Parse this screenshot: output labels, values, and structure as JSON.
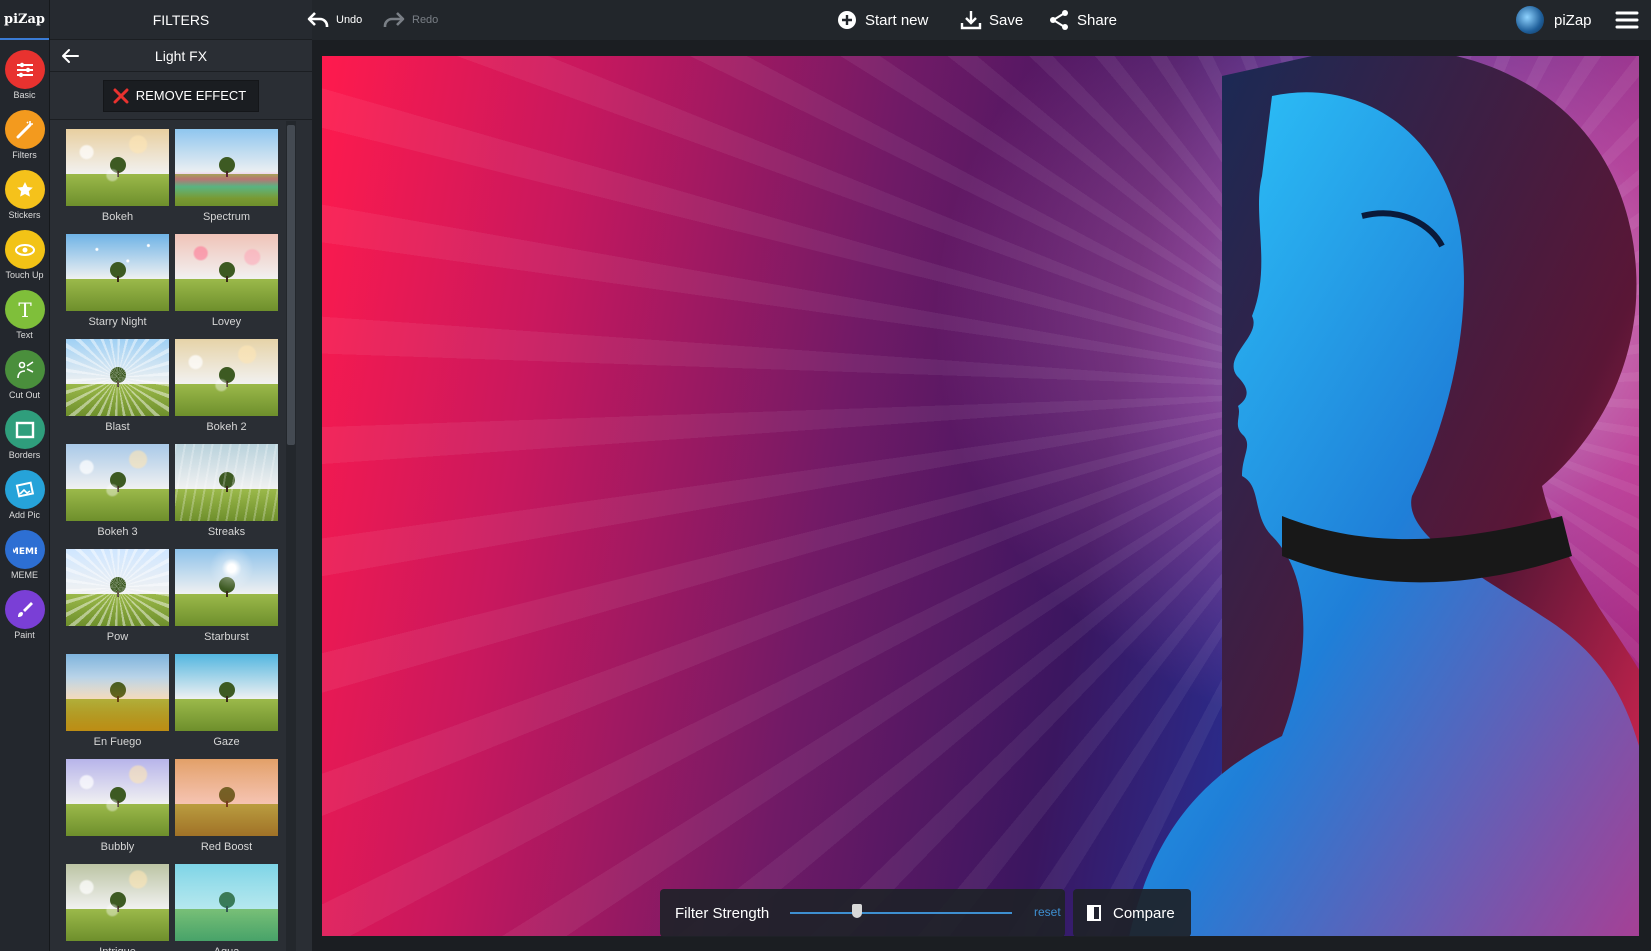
{
  "app": {
    "logo": "piZap"
  },
  "rail": [
    {
      "label": "Basic",
      "icon": "sliders-icon",
      "color": "#e8322f"
    },
    {
      "label": "Filters",
      "icon": "magic-wand-icon",
      "color": "#f39a1e"
    },
    {
      "label": "Stickers",
      "icon": "sticker-icon",
      "color": "#f5c21b"
    },
    {
      "label": "Touch Up",
      "icon": "eye-icon",
      "color": "#f2c316"
    },
    {
      "label": "Text",
      "icon": "text-icon",
      "color": "#7fbf3a"
    },
    {
      "label": "Cut Out",
      "icon": "cutout-icon",
      "color": "#4a8f3c"
    },
    {
      "label": "Borders",
      "icon": "border-icon",
      "color": "#2f9e7c"
    },
    {
      "label": "Add Pic",
      "icon": "add-picture-icon",
      "color": "#26a3d9"
    },
    {
      "label": "MEME",
      "icon": "meme-icon",
      "color": "#2d6fd3"
    },
    {
      "label": "Paint",
      "icon": "paintbrush-icon",
      "color": "#7a3fd6"
    }
  ],
  "panel": {
    "title": "FILTERS",
    "subtitle": "Light FX",
    "remove_label": "REMOVE EFFECT"
  },
  "filters": [
    {
      "label": "Bokeh",
      "sky": "#e8cfa0",
      "fx": "bokeh"
    },
    {
      "label": "Spectrum",
      "sky": "#8fc6ef",
      "fx": "spectrum"
    },
    {
      "label": "Starry Night",
      "sky": "#6fb3e6",
      "fx": "stars"
    },
    {
      "label": "Lovey",
      "sky": "#f0c3b8",
      "fx": "hearts"
    },
    {
      "label": "Blast",
      "sky": "#9fd0f4",
      "fx": "blast"
    },
    {
      "label": "Bokeh 2",
      "sky": "#e6d3a8",
      "fx": "bokeh"
    },
    {
      "label": "Bokeh 3",
      "sky": "#a9c9e8",
      "fx": "bokeh"
    },
    {
      "label": "Streaks",
      "sky": "#b9d2dc",
      "fx": "streaks"
    },
    {
      "label": "Pow",
      "sky": "#cfe6ff",
      "fx": "blast"
    },
    {
      "label": "Starburst",
      "sky": "#8ec2ea",
      "fx": "starburst"
    },
    {
      "label": "En Fuego",
      "sky": "#7fb4dd",
      "fx": "fire"
    },
    {
      "label": "Gaze",
      "sky": "#53b6e0",
      "fx": "none"
    },
    {
      "label": "Bubbly",
      "sky": "#b7b4ea",
      "fx": "bokeh"
    },
    {
      "label": "Red Boost",
      "sky": "#d9a077",
      "fx": "red"
    },
    {
      "label": "Intrigue",
      "sky": "#bcc4a4",
      "fx": "bokeh"
    },
    {
      "label": "Aqua",
      "sky": "#7fd0e0",
      "fx": "aqua"
    }
  ],
  "toolbar": {
    "undo_label": "Undo",
    "redo_label": "Redo",
    "start_new_label": "Start new",
    "save_label": "Save",
    "share_label": "Share",
    "user_name": "piZap"
  },
  "controls": {
    "strength_label": "Filter Strength",
    "strength_value": 0.3,
    "reset_label": "reset",
    "compare_label": "Compare"
  }
}
